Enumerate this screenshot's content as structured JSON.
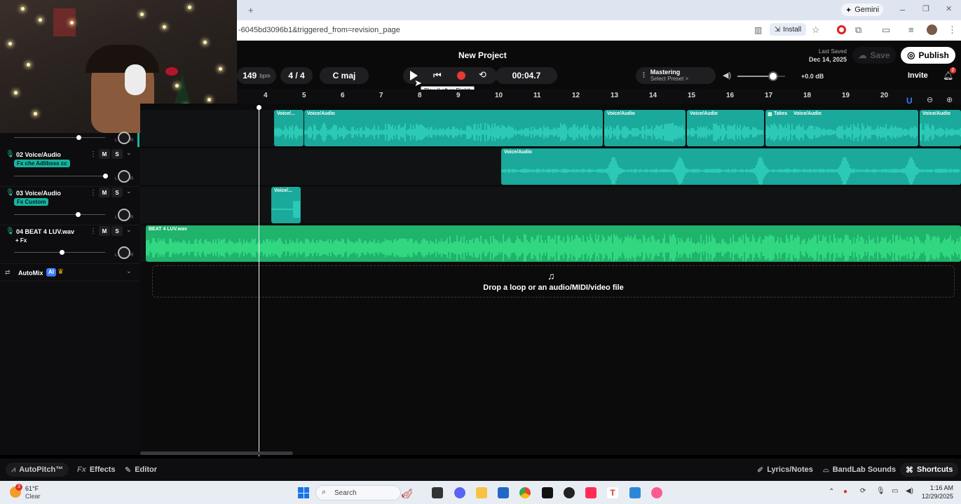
{
  "browser": {
    "new_tab_glyph": "+",
    "url": "-6045bd3096b1&triggered_from=revision_page",
    "gemini_label": "Gemini",
    "install_label": "Install",
    "window_controls": [
      "–",
      "❐",
      "✕"
    ]
  },
  "project": {
    "title": "New Project",
    "last_saved_label": "Last Saved",
    "last_saved_date": "Dec 14, 2025",
    "save_label": "Save",
    "publish_label": "Publish",
    "invite_label": "Invite",
    "notification_count": "2"
  },
  "transport": {
    "bpm_value": "149",
    "bpm_unit": "bpm",
    "time_signature": "4 / 4",
    "key": "C maj",
    "time": "00:04.7",
    "play_tooltip": "Play (Left or Right)"
  },
  "mastering": {
    "label": "Mastering",
    "preset": "Select Preset >"
  },
  "master_volume": {
    "db_label": "+0.0 dB",
    "level": 0.75
  },
  "ruler": {
    "bars": [
      "4",
      "5",
      "6",
      "7",
      "8",
      "9",
      "10",
      "11",
      "12",
      "13",
      "14",
      "15",
      "16",
      "17",
      "18",
      "19",
      "20"
    ]
  },
  "tracks": [
    {
      "number": "02",
      "name": "Voice/Audio",
      "fx": "Fx che Adlibsss cc",
      "mute": "M",
      "solo": "S",
      "pan_l": "L",
      "pan_r": "R",
      "volume": 1.0
    },
    {
      "number": "03",
      "name": "Voice/Audio",
      "fx": "Fx Custom",
      "mute": "M",
      "solo": "S",
      "pan_l": "L",
      "pan_r": "R",
      "volume": 0.7
    },
    {
      "number": "04",
      "name": "BEAT 4 LUV.wav",
      "fx": "+ Fx",
      "mute": "M",
      "solo": "S",
      "pan_l": "L",
      "pan_r": "R",
      "volume": 0.52
    }
  ],
  "top_partial_track": {
    "pan_l": "L",
    "pan_r": "R"
  },
  "automix": {
    "label": "AutoMix",
    "badge": "AI"
  },
  "clips": {
    "lane1": [
      "Voice/...",
      "Voice/Audio",
      "Voice/Audio",
      "Voice/Audio",
      "Takes",
      "Voice/Audio",
      "Voice/Audio"
    ],
    "lane2": [
      "Voice/Audio"
    ],
    "lane3": [
      "Voice/..."
    ],
    "lane4": [
      "BEAT 4 LUV.wav"
    ]
  },
  "dropzone": {
    "text": "Drop a loop or an audio/MIDI/video file"
  },
  "bottom_bar": {
    "autopitch": "AutoPitch™",
    "effects_prefix": "Fx",
    "effects": "Effects",
    "editor": "Editor",
    "lyrics": "Lyrics/Notes",
    "sounds": "BandLab Sounds",
    "shortcuts": "Shortcuts"
  },
  "taskbar": {
    "weather_temp": "61°F",
    "weather_desc": "Clear",
    "weather_badge": "3",
    "search_placeholder": "Search",
    "time": "1:16 AM",
    "date": "12/29/2025"
  },
  "colors": {
    "teal_clip": "#1aa99a",
    "green_clip": "#1fb36c",
    "record_red": "#e53935",
    "accent_blue": "#3d7bff"
  }
}
